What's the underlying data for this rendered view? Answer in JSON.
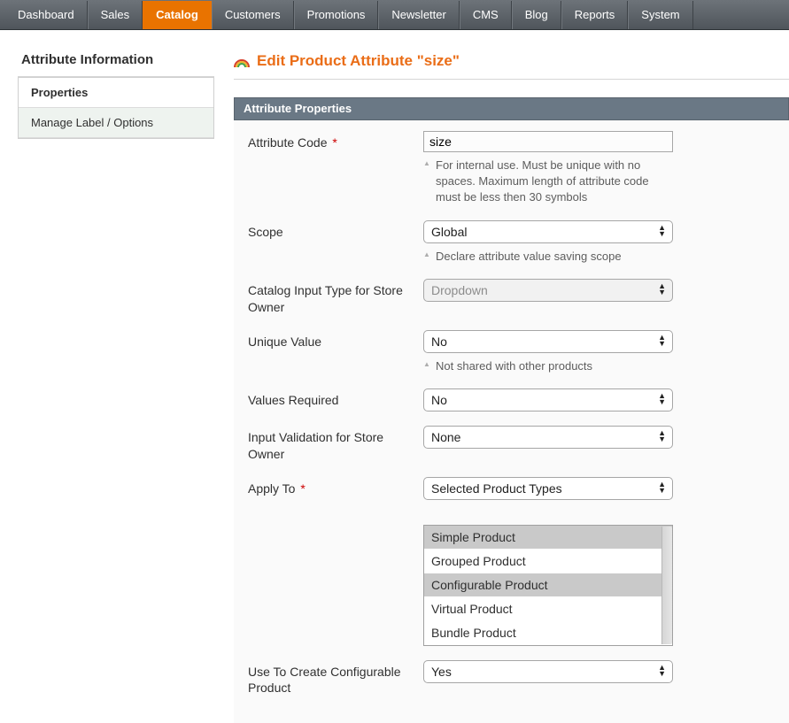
{
  "topnav": {
    "items": [
      "Dashboard",
      "Sales",
      "Catalog",
      "Customers",
      "Promotions",
      "Newsletter",
      "CMS",
      "Blog",
      "Reports",
      "System"
    ],
    "active_index": 2
  },
  "sidebar": {
    "title": "Attribute Information",
    "tabs": [
      {
        "label": "Properties",
        "active": true
      },
      {
        "label": "Manage Label / Options",
        "active": false
      }
    ]
  },
  "page": {
    "title": "Edit Product Attribute \"size\""
  },
  "section": {
    "heading": "Attribute Properties"
  },
  "form": {
    "attribute_code": {
      "label": "Attribute Code",
      "value": "size",
      "hint": "For internal use. Must be unique with no spaces. Maximum length of attribute code must be less then 30 symbols"
    },
    "scope": {
      "label": "Scope",
      "value": "Global",
      "hint": "Declare attribute value saving scope"
    },
    "catalog_input_type": {
      "label": "Catalog Input Type for Store Owner",
      "value": "Dropdown"
    },
    "unique_value": {
      "label": "Unique Value",
      "value": "No",
      "hint": "Not shared with other products"
    },
    "values_required": {
      "label": "Values Required",
      "value": "No"
    },
    "input_validation": {
      "label": "Input Validation for Store Owner",
      "value": "None"
    },
    "apply_to": {
      "label": "Apply To",
      "value": "Selected Product Types",
      "options": [
        {
          "label": "Simple Product",
          "selected": true
        },
        {
          "label": "Grouped Product",
          "selected": false
        },
        {
          "label": "Configurable Product",
          "selected": true
        },
        {
          "label": "Virtual Product",
          "selected": false
        },
        {
          "label": "Bundle Product",
          "selected": false
        }
      ]
    },
    "use_to_create_configurable": {
      "label": "Use To Create Configurable Product",
      "value": "Yes"
    }
  }
}
